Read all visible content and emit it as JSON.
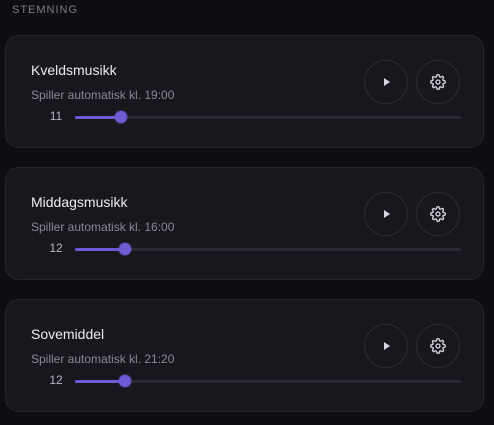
{
  "section": {
    "title": "STEMNING"
  },
  "theme": {
    "accent": "#6e5bd6",
    "card_bg": "#17171e",
    "page_bg": "#0e0e12"
  },
  "scenes": [
    {
      "title": "Kveldsmusikk",
      "subtitle": "Spiller automatisk kl. 19:00",
      "level": "11",
      "level_fraction": 0.12,
      "play_icon": "play-icon",
      "settings_icon": "gear-icon"
    },
    {
      "title": "Middagsmusikk",
      "subtitle": "Spiller automatisk kl. 16:00",
      "level": "12",
      "level_fraction": 0.13,
      "play_icon": "play-icon",
      "settings_icon": "gear-icon"
    },
    {
      "title": "Sovemiddel",
      "subtitle": "Spiller automatisk kl. 21:20",
      "level": "12",
      "level_fraction": 0.13,
      "play_icon": "play-icon",
      "settings_icon": "gear-icon"
    }
  ]
}
